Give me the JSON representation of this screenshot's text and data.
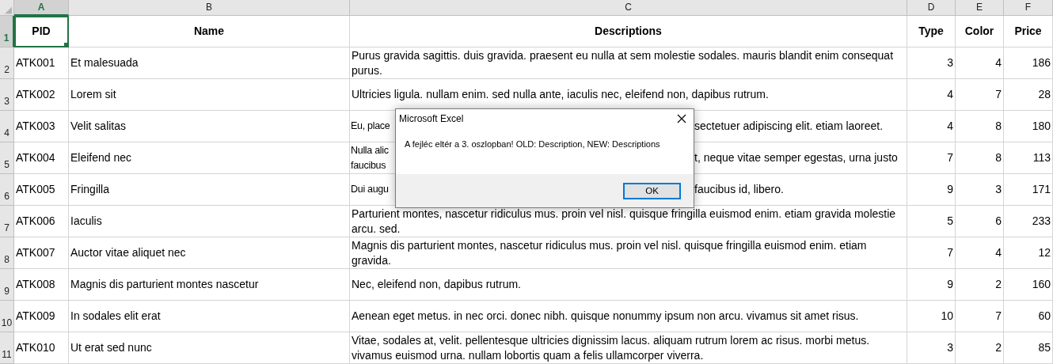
{
  "columns": [
    {
      "letter": "A",
      "selected": true
    },
    {
      "letter": "B",
      "selected": false
    },
    {
      "letter": "C",
      "selected": false
    },
    {
      "letter": "D",
      "selected": false
    },
    {
      "letter": "E",
      "selected": false
    },
    {
      "letter": "F",
      "selected": false
    }
  ],
  "header": {
    "number": "1",
    "selected": true,
    "cells": [
      "PID",
      "Name",
      "Descriptions",
      "Type",
      "Color",
      "Price"
    ]
  },
  "rows": [
    {
      "number": "2",
      "selected": false,
      "pid": "ATK001",
      "name": "Et malesuada",
      "description": "Purus gravida sagittis. duis gravida. praesent eu nulla at sem molestie sodales. mauris blandit enim consequat purus.",
      "type": "3",
      "color_id": "4",
      "price": "186"
    },
    {
      "number": "3",
      "selected": false,
      "pid": "ATK002",
      "name": "Lorem sit",
      "description": "Ultricies ligula. nullam enim. sed nulla ante, iaculis nec, eleifend non, dapibus rutrum.",
      "type": "4",
      "color_id": "7",
      "price": "28"
    },
    {
      "number": "4",
      "selected": false,
      "pid": "ATK003",
      "name": "Velit salitas",
      "description_visible": {
        "left_lines": [
          "Eu, place"
        ],
        "right_lines": [
          "sectetuer adipiscing elit. etiam laoreet."
        ]
      },
      "type": "4",
      "color_id": "8",
      "price": "180"
    },
    {
      "number": "5",
      "selected": false,
      "pid": "ATK004",
      "name": "Eleifend nec",
      "description_visible": {
        "left_lines": [
          "Nulla alic",
          "faucibus"
        ],
        "right_lines": [
          "t, neque vitae semper egestas, urna justo"
        ]
      },
      "type": "7",
      "color_id": "8",
      "price": "113"
    },
    {
      "number": "6",
      "selected": false,
      "pid": "ATK005",
      "name": "Fringilla",
      "description_visible": {
        "left_lines": [
          "Dui augu"
        ],
        "right_lines": [
          "faucibus id, libero."
        ]
      },
      "type": "9",
      "color_id": "3",
      "price": "171"
    },
    {
      "number": "7",
      "selected": false,
      "pid": "ATK006",
      "name": "Iaculis",
      "description": "Parturient montes, nascetur ridiculus mus. proin vel nisl. quisque fringilla euismod enim. etiam gravida molestie arcu. sed.",
      "type": "5",
      "color_id": "6",
      "price": "233"
    },
    {
      "number": "8",
      "selected": false,
      "pid": "ATK007",
      "name": "Auctor vitae aliquet nec",
      "description": "Magnis dis parturient montes, nascetur ridiculus mus. proin vel nisl. quisque fringilla euismod enim. etiam gravida.",
      "type": "7",
      "color_id": "4",
      "price": "12"
    },
    {
      "number": "9",
      "selected": false,
      "pid": "ATK008",
      "name": "Magnis dis parturient montes nascetur",
      "description": "Nec, eleifend non, dapibus rutrum.",
      "type": "9",
      "color_id": "2",
      "price": "160"
    },
    {
      "number": "10",
      "selected": false,
      "pid": "ATK009",
      "name": "In sodales elit erat",
      "description": "Aenean eget metus. in nec orci. donec nibh. quisque nonummy ipsum non arcu. vivamus sit amet risus.",
      "type": "10",
      "color_id": "7",
      "price": "60"
    },
    {
      "number": "11",
      "selected": false,
      "pid": "ATK010",
      "name": "Ut erat sed nunc",
      "description": "Vitae, sodales at, velit. pellentesque ultricies dignissim lacus. aliquam rutrum lorem ac risus. morbi metus. vivamus euismod urna. nullam lobortis quam a felis ullamcorper viverra.",
      "type": "3",
      "color_id": "2",
      "price": "85"
    }
  ],
  "dialog": {
    "title": "Microsoft Excel",
    "message": "A fejléc eltér a 3. oszlopban! OLD: Description, NEW: Descriptions",
    "buttons": [
      {
        "label": "OK",
        "selected": true
      }
    ]
  }
}
